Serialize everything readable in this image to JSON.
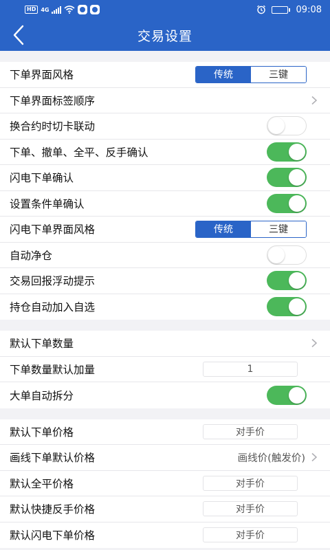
{
  "status_bar": {
    "hd": "HD",
    "net": "4G",
    "time": "09:08",
    "icons": [
      "wifi-icon",
      "app-icon",
      "alarm-icon",
      "battery-icon"
    ]
  },
  "header": {
    "title": "交易设置",
    "back_icon": "chevron-left-icon"
  },
  "sections": [
    {
      "rows": [
        {
          "label": "下单界面风格",
          "control": "segment",
          "options": [
            "传统",
            "三键"
          ],
          "selected": 0
        },
        {
          "label": "下单界面标签顺序",
          "control": "chevron"
        },
        {
          "label": "换合约时切卡联动",
          "control": "toggle",
          "on": false
        },
        {
          "label": "下单、撤单、全平、反手确认",
          "control": "toggle",
          "on": true
        },
        {
          "label": "闪电下单确认",
          "control": "toggle",
          "on": true
        },
        {
          "label": "设置条件单确认",
          "control": "toggle",
          "on": true
        },
        {
          "label": "闪电下单界面风格",
          "control": "segment",
          "options": [
            "传统",
            "三键"
          ],
          "selected": 0
        },
        {
          "label": "自动净仓",
          "control": "toggle",
          "on": false
        },
        {
          "label": "交易回报浮动提示",
          "control": "toggle",
          "on": true
        },
        {
          "label": "持仓自动加入自选",
          "control": "toggle",
          "on": true
        }
      ]
    },
    {
      "rows": [
        {
          "label": "默认下单数量",
          "control": "chevron"
        },
        {
          "label": "下单数量默认加量",
          "control": "value",
          "value": "1"
        },
        {
          "label": "大单自动拆分",
          "control": "toggle",
          "on": true
        }
      ]
    },
    {
      "rows": [
        {
          "label": "默认下单价格",
          "control": "value",
          "value": "对手价"
        },
        {
          "label": "画线下单默认价格",
          "control": "link",
          "value": "画线价(触发价)"
        },
        {
          "label": "默认全平价格",
          "control": "value",
          "value": "对手价"
        },
        {
          "label": "默认快捷反手价格",
          "control": "value",
          "value": "对手价"
        },
        {
          "label": "默认闪电下单价格",
          "control": "value",
          "value": "对手价"
        }
      ]
    }
  ],
  "colors": {
    "primary": "#2a64c7",
    "toggle_on": "#4cb85a",
    "background": "#f2f2f5"
  }
}
